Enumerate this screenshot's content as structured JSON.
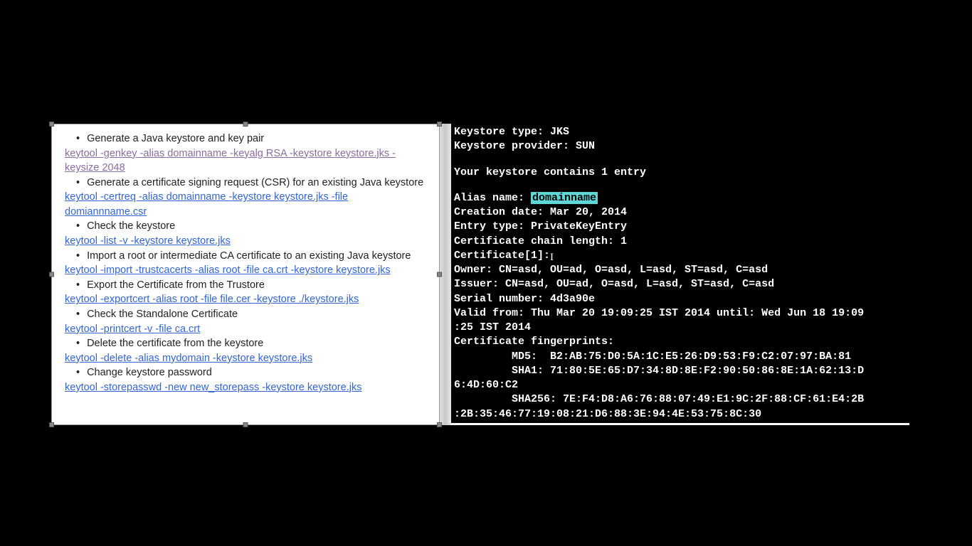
{
  "left": {
    "items": [
      {
        "type": "bullet",
        "text": "Generate a Java keystore and key pair"
      },
      {
        "type": "cmd",
        "visited": true,
        "text": "keytool -genkey -alias domainname -keyalg RSA -keystore keystore.jks -keysize 2048"
      },
      {
        "type": "bullet",
        "text": "Generate a certificate signing request (CSR) for an existing Java keystore"
      },
      {
        "type": "cmd",
        "text": "keytool -certreq -alias domainname -keystore keystore.jks -file domiannname.csr"
      },
      {
        "type": "bullet",
        "text": "Check the keystore"
      },
      {
        "type": "cmd",
        "text": "keytool -list -v -keystore keystore.jks"
      },
      {
        "type": "bullet",
        "text": "Import a root or intermediate CA certificate to an existing Java keystore"
      },
      {
        "type": "cmd",
        "text": "keytool -import -trustcacerts -alias root -file ca.crt -keystore keystore.jks"
      },
      {
        "type": "bullet",
        "text": "Export the Certificate from the Trustore"
      },
      {
        "type": "cmd",
        "text": "keytool -exportcert -alias root -file file.cer -keystore ./keystore.jks"
      },
      {
        "type": "bullet",
        "text": "Check the Standalone Certificate"
      },
      {
        "type": "cmd",
        "text": "keytool -printcert -v -file ca.crt"
      },
      {
        "type": "bullet",
        "text": "Delete the certificate from the keystore"
      },
      {
        "type": "cmd",
        "text": "keytool -delete -alias mydomain -keystore keystore.jks"
      },
      {
        "type": "bullet",
        "text": "Change keystore password"
      },
      {
        "type": "cmd",
        "text": "keytool -storepasswd -new new_storepass -keystore keystore.jks"
      }
    ]
  },
  "terminal": {
    "keystore_type": "Keystore type: JKS",
    "keystore_provider": "Keystore provider: SUN",
    "contains": "Your keystore contains 1 entry",
    "alias_label": "Alias name: ",
    "alias_value": "domainname",
    "creation": "Creation date: Mar 20, 2014",
    "entry_type": "Entry type: PrivateKeyEntry",
    "chain_len": "Certificate chain length: 1",
    "cert_header": "Certificate[1]:",
    "owner": "Owner: CN=asd, OU=ad, O=asd, L=asd, ST=asd, C=asd",
    "issuer": "Issuer: CN=asd, OU=ad, O=asd, L=asd, ST=asd, C=asd",
    "serial": "Serial number: 4d3a90e",
    "valid1": "Valid from: Thu Mar 20 19:09:25 IST 2014 until: Wed Jun 18 19:09",
    "valid2": ":25 IST 2014",
    "fp_header": "Certificate fingerprints:",
    "md5": "         MD5:  B2:AB:75:D0:5A:1C:E5:26:D9:53:F9:C2:07:97:BA:81",
    "sha1": "         SHA1: 71:80:5E:65:D7:34:8D:8E:F2:90:50:86:8E:1A:62:13:D",
    "sha1b": "6:4D:60:C2",
    "sha256": "         SHA256: 7E:F4:D8:A6:76:88:07:49:E1:9C:2F:88:CF:61:E4:2B",
    "sha256b": ":2B:35:46:77:19:08:21:D6:88:3E:94:4E:53:75:8C:30"
  }
}
